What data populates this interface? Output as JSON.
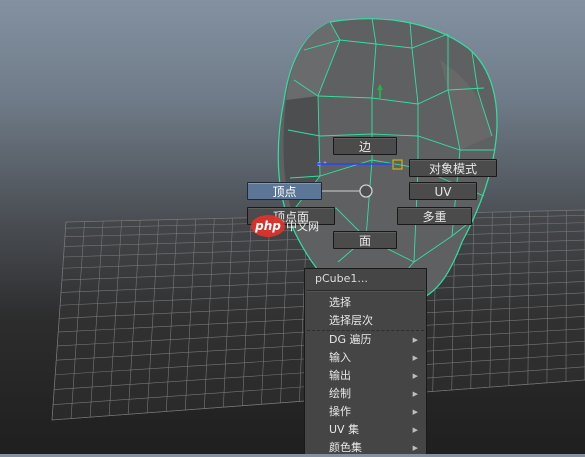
{
  "marking_menu": {
    "edge": "边",
    "object_mode": "对象模式",
    "vertex": "顶点",
    "uv": "UV",
    "vertex_face": "顶点面",
    "multi": "多重",
    "face": "面"
  },
  "context_menu": {
    "title": "pCube1...",
    "items": [
      {
        "label": "选择",
        "submenu": false
      },
      {
        "label": "选择层次",
        "submenu": false
      },
      {
        "label": "DG 遍历",
        "submenu": true
      },
      {
        "label": "输入",
        "submenu": true
      },
      {
        "label": "输出",
        "submenu": true
      },
      {
        "label": "绘制",
        "submenu": true
      },
      {
        "label": "操作",
        "submenu": true
      },
      {
        "label": "UV 集",
        "submenu": true
      },
      {
        "label": "颜色集",
        "submenu": true
      }
    ],
    "arrow_icon": "submenu-arrow-icon"
  },
  "watermark": {
    "text": "php",
    "suffix": "中文网"
  },
  "colors": {
    "wireframe_highlight": "#31e0a0",
    "mesh_gray": "#5f6061",
    "active_button": "#5b7696",
    "menu_bg": "#454545"
  }
}
